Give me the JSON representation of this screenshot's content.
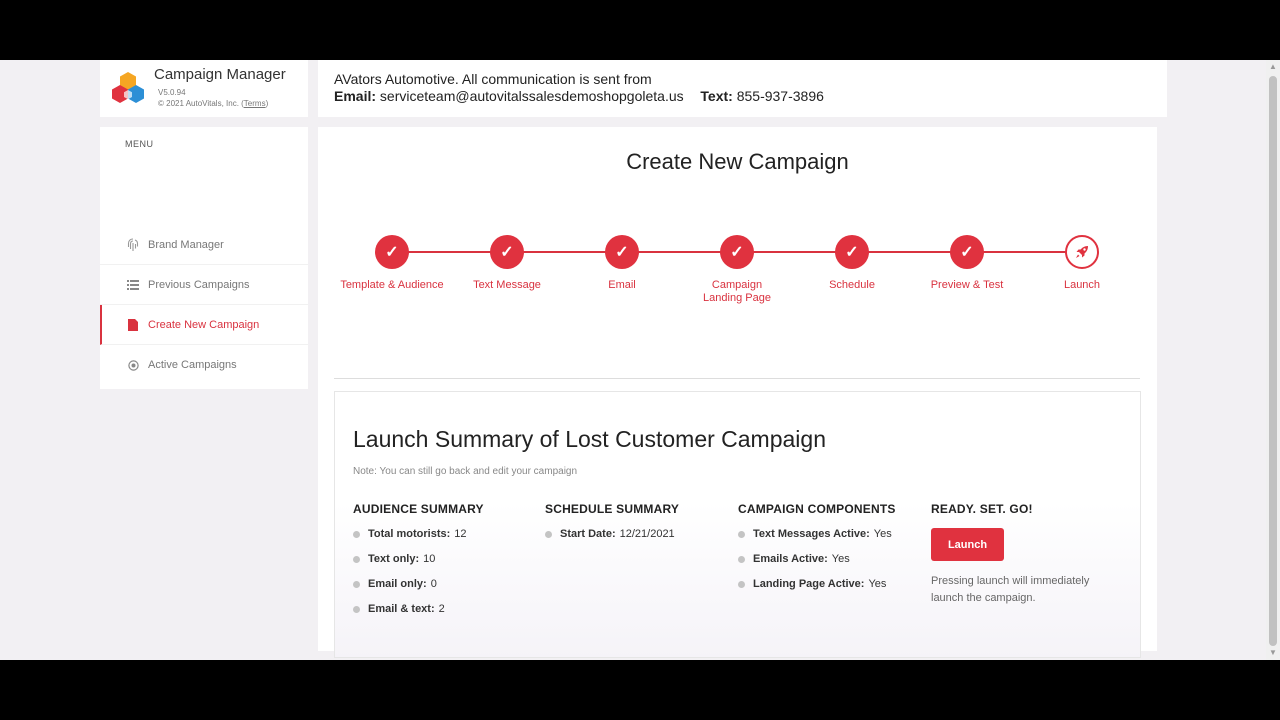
{
  "brand": {
    "title": "Campaign Manager",
    "version": "V5.0.94",
    "copyright": "© 2021 AutoVitals, Inc. (",
    "terms_link": "Terms",
    "copyright_close": ")"
  },
  "menu": {
    "heading": "MENU",
    "items": [
      {
        "label": "Brand Manager",
        "icon": "fingerprint-icon"
      },
      {
        "label": "Previous Campaigns",
        "icon": "list-icon"
      },
      {
        "label": "Create New Campaign",
        "icon": "file-icon",
        "active": true
      },
      {
        "label": "Active Campaigns",
        "icon": "radio-circle-icon"
      }
    ]
  },
  "header": {
    "line1": "AVators Automotive. All communication is sent from",
    "email_label": "Email:",
    "email_value": "serviceteam@autovitalssalesdemoshopgoleta.us",
    "text_label": "Text:",
    "text_value": "855-937-3896"
  },
  "page": {
    "title": "Create New Campaign"
  },
  "steps": [
    {
      "label": "Template & Audience",
      "status": "complete",
      "icon": "check-icon"
    },
    {
      "label": "Text Message",
      "status": "complete",
      "icon": "check-icon"
    },
    {
      "label": "Email",
      "status": "complete",
      "icon": "check-icon"
    },
    {
      "label": "Campaign Landing Page",
      "status": "complete",
      "icon": "check-icon"
    },
    {
      "label": "Schedule",
      "status": "complete",
      "icon": "check-icon"
    },
    {
      "label": "Preview & Test",
      "status": "complete",
      "icon": "check-icon"
    },
    {
      "label": "Launch",
      "status": "current",
      "icon": "rocket-icon"
    }
  ],
  "summary": {
    "title": "Launch Summary of Lost Customer Campaign",
    "note": "Note: You can still go back and edit your campaign",
    "audience": {
      "heading": "AUDIENCE SUMMARY",
      "items": [
        {
          "label": "Total motorists:",
          "value": "12"
        },
        {
          "label": "Text only:",
          "value": "10"
        },
        {
          "label": "Email only:",
          "value": "0"
        },
        {
          "label": "Email & text:",
          "value": "2"
        }
      ]
    },
    "schedule": {
      "heading": "SCHEDULE SUMMARY",
      "items": [
        {
          "label": "Start Date:",
          "value": "12/21/2021"
        }
      ]
    },
    "components": {
      "heading": "CAMPAIGN COMPONENTS",
      "items": [
        {
          "label": "Text Messages Active:",
          "value": "Yes"
        },
        {
          "label": "Emails Active:",
          "value": "Yes"
        },
        {
          "label": "Landing Page Active:",
          "value": "Yes"
        }
      ]
    },
    "go": {
      "heading": "READY. SET. GO!",
      "button": "Launch",
      "note": "Pressing launch will immediately launch the campaign."
    }
  },
  "colors": {
    "accent": "#e0323f",
    "background": "#f2f0f3"
  }
}
